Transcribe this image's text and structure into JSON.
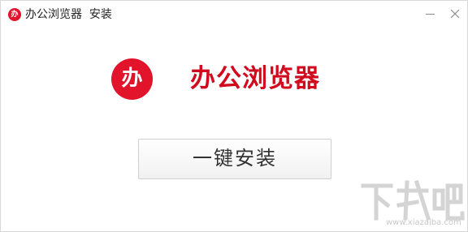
{
  "window": {
    "title": "办公浏览器  安装",
    "title_logo_glyph": "办",
    "title_logo_icon": "office-browser-logo-icon",
    "minimize_icon": "minimize-icon",
    "close_icon": "close-icon"
  },
  "brand": {
    "logo_glyph": "办",
    "logo_icon": "office-browser-logo-icon",
    "name": "办公浏览器"
  },
  "actions": {
    "install_label": "一键安装"
  },
  "watermark": {
    "text": "下载吧",
    "url": "www.xiazaiba.com"
  },
  "colors": {
    "brand_red": "#e1142b",
    "brand_text_red": "#d10a1e",
    "button_border": "#cfcfcf",
    "background": "#ffffff"
  }
}
